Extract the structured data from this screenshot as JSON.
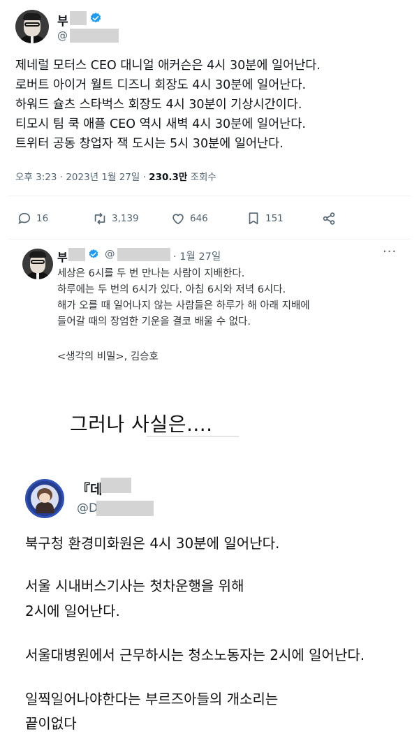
{
  "tweet1": {
    "name": "부",
    "handle": "@",
    "lines": [
      "제네럴 모터스 CEO 대니얼 애커슨은 4시 30분에 일어난다.",
      "로버트 아이거 월트 디즈니 회장도 4시 30분에 일어난다.",
      "하워드 슐츠 스타벅스 회장도 4시 30분이 기상시간이다.",
      "티모시 팀 쿡 애플 CEO 역시 새벽 4시 30분에 일어난다.",
      "트위터 공동 창업자 잭 도시는 5시 30분에 일어난다."
    ],
    "timestamp": "오후 3:23 · 2023년 1월 27일 · ",
    "views_count": "230.3만",
    "views_label": " 조회수",
    "actions": {
      "reply_count": "16",
      "retweet_count": "3,139",
      "like_count": "646",
      "bookmark_count": "151"
    }
  },
  "tweet2": {
    "name": "부",
    "handle": "@",
    "date": "· 1월 27일",
    "more": "···",
    "lines": [
      "세상은 6시를 두 번 만나는 사람이 지배한다.",
      "하루에는 두 번의 6시가 있다. 아침 6시와 저녁 6시다.",
      "해가 오를 때 일어나지 않는 사람들은 하루가 해 아래 지배에",
      "들어갈 때의 장엄한 기운을 결코 배울 수 없다."
    ],
    "quote": "<생각의 비밀>, 김승호"
  },
  "caption": "그러나 사실은....",
  "tweet3": {
    "name": "『데",
    "handle": "@D",
    "paragraphs": [
      "북구청 환경미화원은 4시 30분에 일어난다.",
      "서울 시내버스기사는 첫차운행을 위해",
      "2시에 일어난다.",
      "서울대병원에서 근무하시는 청소노동자는 2시에 일어난다.",
      "일찍일어나야한다는 부르즈아들의 개소리는",
      "끝이없다"
    ]
  },
  "colors": {
    "verified": "#1d9bf0",
    "secondary_text": "#536471",
    "redaction": "#d4d4d4"
  },
  "icons": [
    "verified-icon",
    "reply-icon",
    "retweet-icon",
    "like-icon",
    "bookmark-icon",
    "share-icon"
  ]
}
